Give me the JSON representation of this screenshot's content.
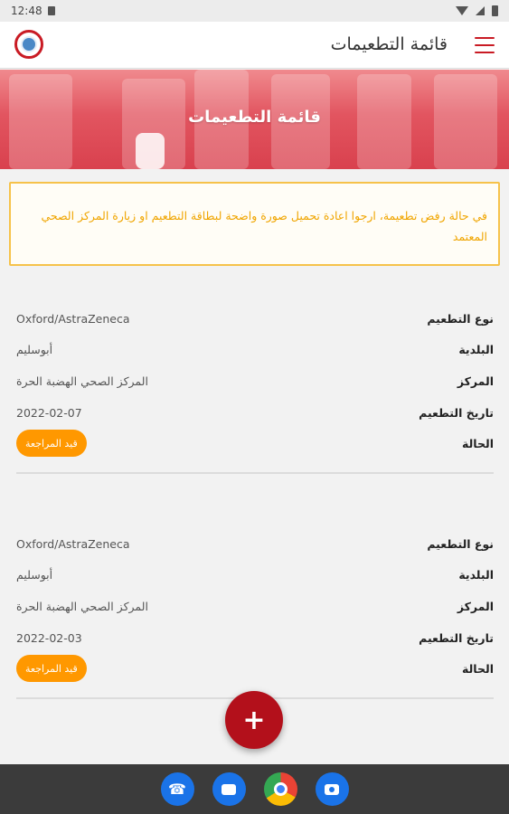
{
  "status_bar": {
    "time": "12:48"
  },
  "app_bar": {
    "title": "قائمة التطعيمات"
  },
  "banner": {
    "title": "قائمة التطعيمات"
  },
  "notice": {
    "text": "في حالة رفض تطعيمة، ارجوا اعادة تحميل صورة واضحة لبطاقة التطعيم او زيارة المركز الصحي المعتمد"
  },
  "labels": {
    "vaccine_type": "نوع التطعيم",
    "municipality": "البلدية",
    "center": "المركز",
    "date": "تاريخ التطعيم",
    "status": "الحالة"
  },
  "records": [
    {
      "vaccine_type": "Oxford/AstraZeneca",
      "municipality": "أبوسليم",
      "center": "المركز الصحي الهضبة الحرة",
      "date": "2022-02-07",
      "status": "قيد المراجعة"
    },
    {
      "vaccine_type": "Oxford/AstraZeneca",
      "municipality": "أبوسليم",
      "center": "المركز الصحي الهضبة الحرة",
      "date": "2022-02-03",
      "status": "قيد المراجعة"
    }
  ],
  "fab": {
    "label": "+"
  },
  "colors": {
    "brand_red": "#b3101b",
    "status_orange": "#ff9800",
    "notice_border": "#f6c24a"
  },
  "dock": {
    "icons": [
      "phone-icon",
      "messages-icon",
      "chrome-icon",
      "camera-icon"
    ]
  }
}
